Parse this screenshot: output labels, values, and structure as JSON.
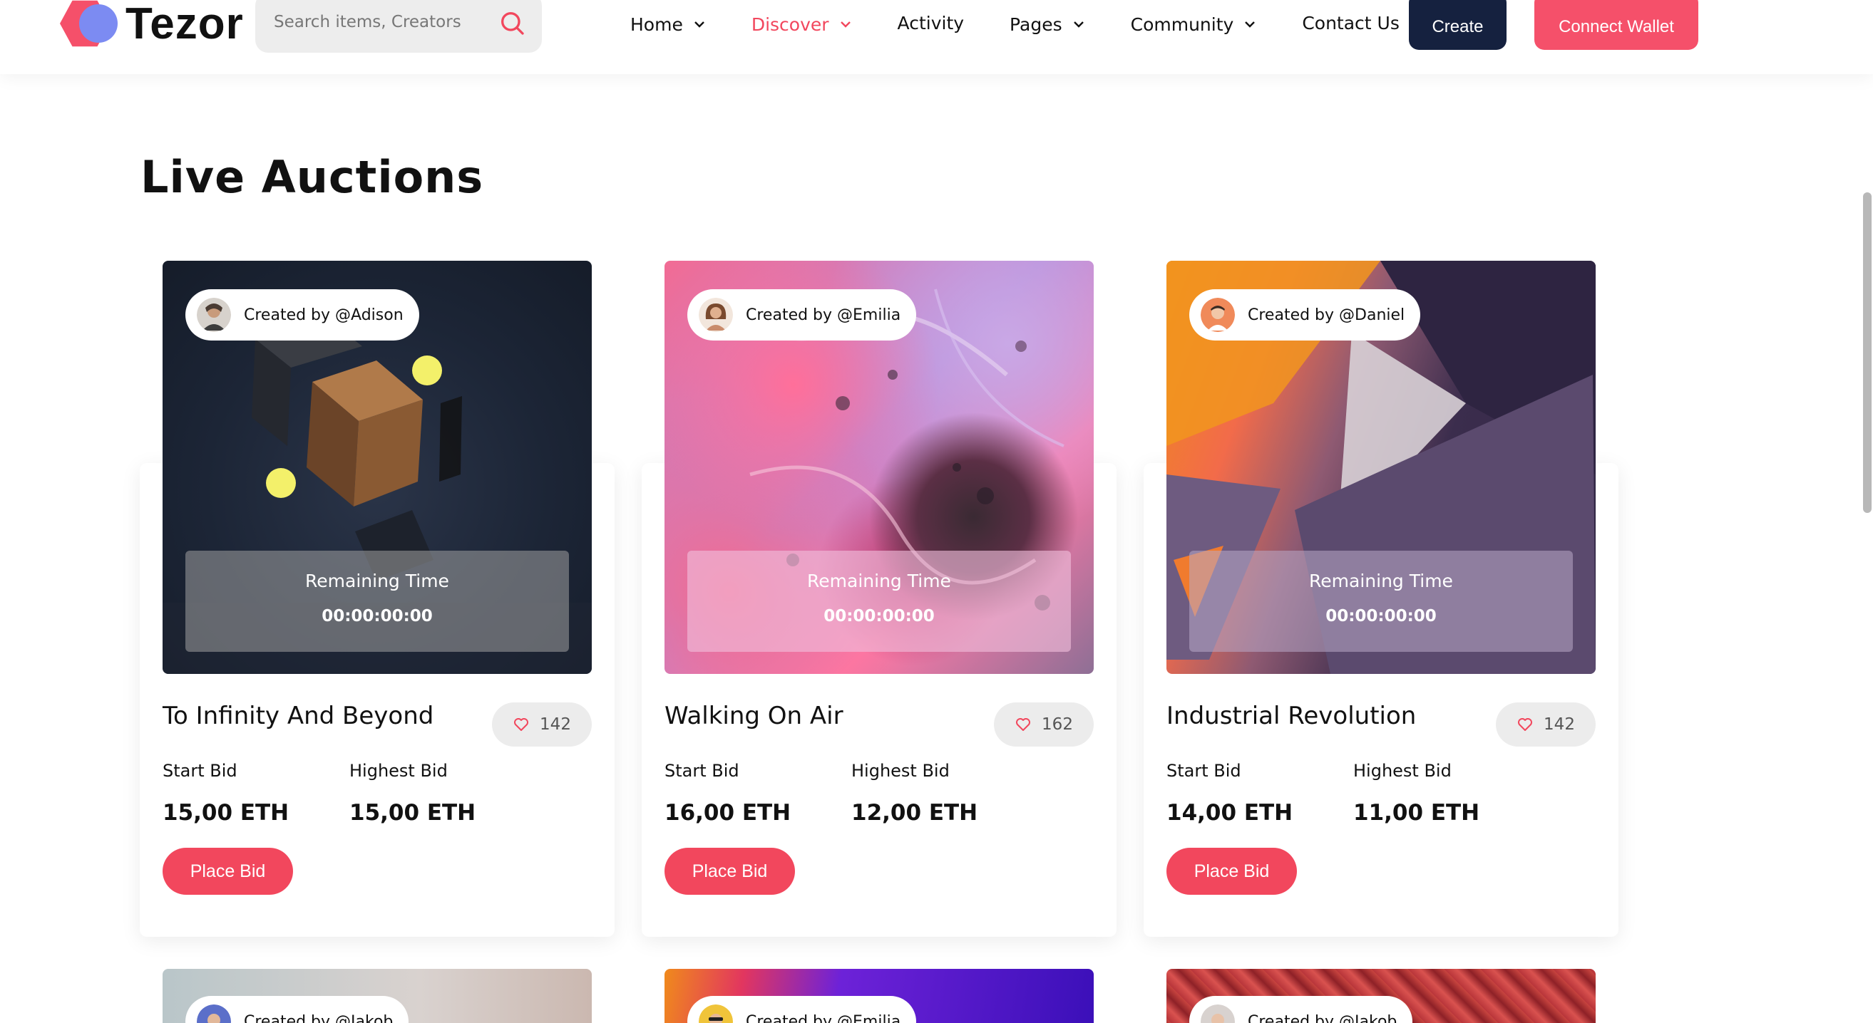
{
  "header": {
    "logo_text": "Tezor",
    "search_placeholder": "Search items, Creators",
    "nav": [
      {
        "label": "Home",
        "has_dropdown": true,
        "active": false
      },
      {
        "label": "Discover",
        "has_dropdown": true,
        "active": true
      },
      {
        "label": "Activity",
        "has_dropdown": false,
        "active": false
      },
      {
        "label": "Pages",
        "has_dropdown": true,
        "active": false
      },
      {
        "label": "Community",
        "has_dropdown": true,
        "active": false
      },
      {
        "label": "Contact Us",
        "has_dropdown": false,
        "active": false
      }
    ],
    "create_label": "Create",
    "wallet_label": "Connect Wallet"
  },
  "page_title": "Live Auctions",
  "cards": [
    {
      "creator": "Created by @Adison",
      "remaining_label": "Remaining Time",
      "remaining_value": "00:00:00:00",
      "title": "To Infinity And Beyond",
      "likes": "142",
      "start_bid_label": "Start Bid",
      "start_bid": "15,00 ETH",
      "highest_bid_label": "Highest Bid",
      "highest_bid": "15,00 ETH",
      "place_bid_label": "Place Bid"
    },
    {
      "creator": "Created by @Emilia",
      "remaining_label": "Remaining Time",
      "remaining_value": "00:00:00:00",
      "title": "Walking On Air",
      "likes": "162",
      "start_bid_label": "Start Bid",
      "start_bid": "16,00 ETH",
      "highest_bid_label": "Highest Bid",
      "highest_bid": "12,00 ETH",
      "place_bid_label": "Place Bid"
    },
    {
      "creator": "Created by @Daniel",
      "remaining_label": "Remaining Time",
      "remaining_value": "00:00:00:00",
      "title": "Industrial Revolution",
      "likes": "142",
      "start_bid_label": "Start Bid",
      "start_bid": "14,00 ETH",
      "highest_bid_label": "Highest Bid",
      "highest_bid": "11,00 ETH",
      "place_bid_label": "Place Bid"
    }
  ],
  "next_row": [
    {
      "creator": "Created by @Jakob"
    },
    {
      "creator": "Created by @Emilia"
    },
    {
      "creator": "Created by @Jakob"
    }
  ],
  "colors": {
    "accent": "#f2475d",
    "dark_button": "#15213f",
    "nav_active": "#f2475d"
  }
}
